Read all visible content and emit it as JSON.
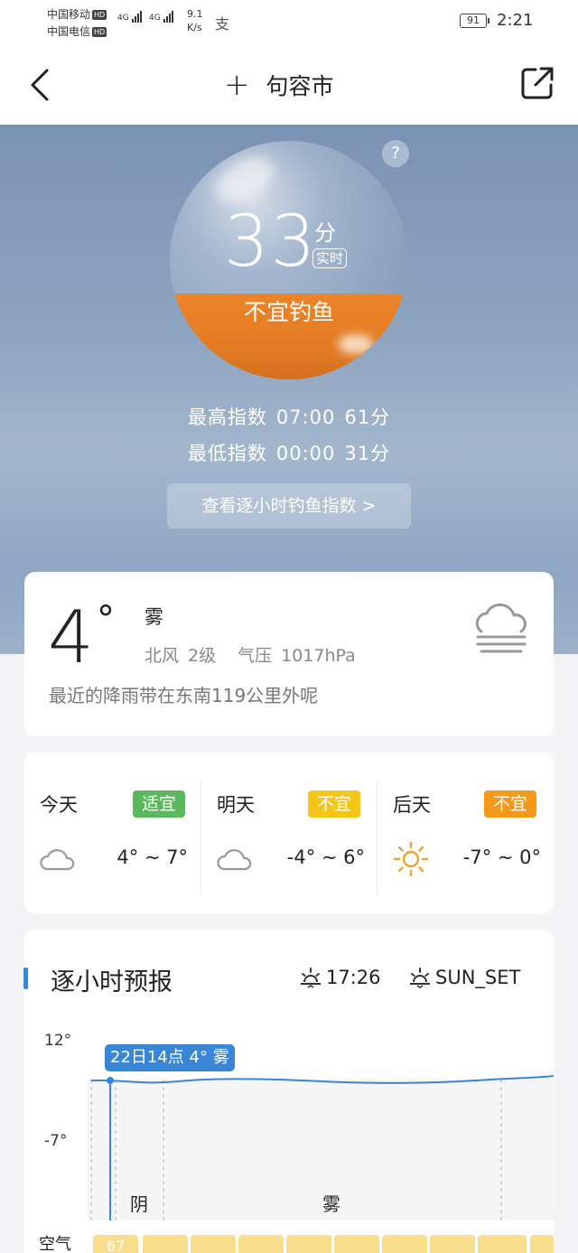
{
  "status_bar": {
    "carrier1": "中国移动",
    "carrier2": "中国电信",
    "hd": "HD",
    "signal_type": "4G",
    "speed_value": "9.1",
    "speed_unit": "K/s",
    "alipay_glyph": "支",
    "battery": "91",
    "time": "2:21"
  },
  "nav": {
    "title": "句容市",
    "plus": "+"
  },
  "hero": {
    "help": "?",
    "score": "33",
    "score_unit": "分",
    "realtime_label": "实时",
    "verdict": "不宜钓鱼",
    "score_fill_fraction": 0.33,
    "max_label": "最高指数",
    "max_time": "07:00",
    "max_score": "61分",
    "min_label": "最低指数",
    "min_time": "00:00",
    "min_score": "31分",
    "hourly_button": "查看逐小时钓鱼指数 >"
  },
  "current": {
    "temp": "4",
    "deg": "°",
    "condition": "雾",
    "wind": "北风",
    "wind_level": "2级",
    "pressure_label": "气压",
    "pressure": "1017hPa",
    "rain_note": "最近的降雨带在东南119公里外呢",
    "icon": "fog-icon"
  },
  "days": [
    {
      "name": "今天",
      "badge": "适宜",
      "badge_color": "#5cb85c",
      "icon": "cloud-icon",
      "range": "4° ~ 7°"
    },
    {
      "name": "明天",
      "badge": "不宜",
      "badge_color": "#f5c518",
      "icon": "cloud-icon",
      "range": "-4° ~ 6°"
    },
    {
      "name": "后天",
      "badge": "不宜",
      "badge_color": "#f49a1a",
      "icon": "sun-icon",
      "range": "-7° ~ 0°"
    }
  ],
  "hourly": {
    "title": "逐小时预报",
    "sunrise_time": "17:26",
    "sunset_label": "SUN_SET",
    "y_max": "12°",
    "y_min": "-7°",
    "tooltip": "22日14点 4° 雾",
    "weather_labels": [
      "阴",
      "雾"
    ],
    "aq_label": "空气",
    "aq_first": "67",
    "accent": "#3a86d6"
  }
}
